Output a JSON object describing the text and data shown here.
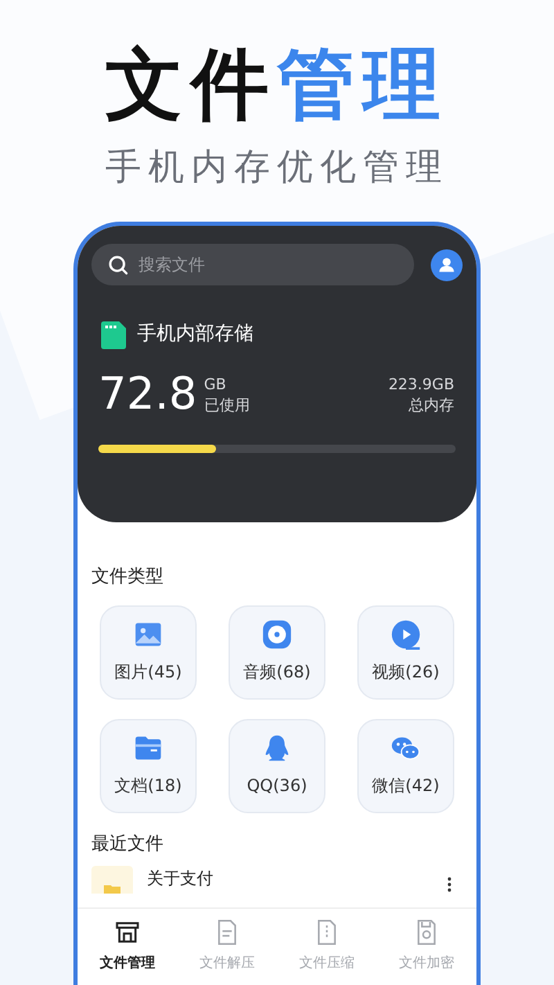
{
  "headline": {
    "dark": "文件",
    "accent": "管理"
  },
  "subtitle": "手机内存优化管理",
  "search": {
    "placeholder": "搜索文件"
  },
  "storage": {
    "title": "手机内部存储",
    "used": "72.8",
    "used_unit": "GB",
    "used_label": "已使用",
    "total": "223.9GB",
    "total_label": "总内存",
    "level": 0.33
  },
  "file_types": {
    "title": "文件类型",
    "items": [
      {
        "kind": "image",
        "label": "图片(45)"
      },
      {
        "kind": "audio",
        "label": "音频(68)"
      },
      {
        "kind": "video",
        "label": "视频(26)"
      },
      {
        "kind": "document",
        "label": "文档(18)"
      },
      {
        "kind": "qq",
        "label": "QQ(36)"
      },
      {
        "kind": "chat",
        "label": "微信(42)"
      }
    ]
  },
  "recent": {
    "title": "最近文件",
    "items": [
      {
        "name": "关于支付"
      }
    ]
  },
  "tabs": [
    {
      "kind": "manage",
      "label": "文件管理",
      "selected": true
    },
    {
      "kind": "extract",
      "label": "文件解压",
      "selected": false
    },
    {
      "kind": "compress",
      "label": "文件压缩",
      "selected": false
    },
    {
      "kind": "encrypt",
      "label": "文件加密",
      "selected": false
    }
  ]
}
